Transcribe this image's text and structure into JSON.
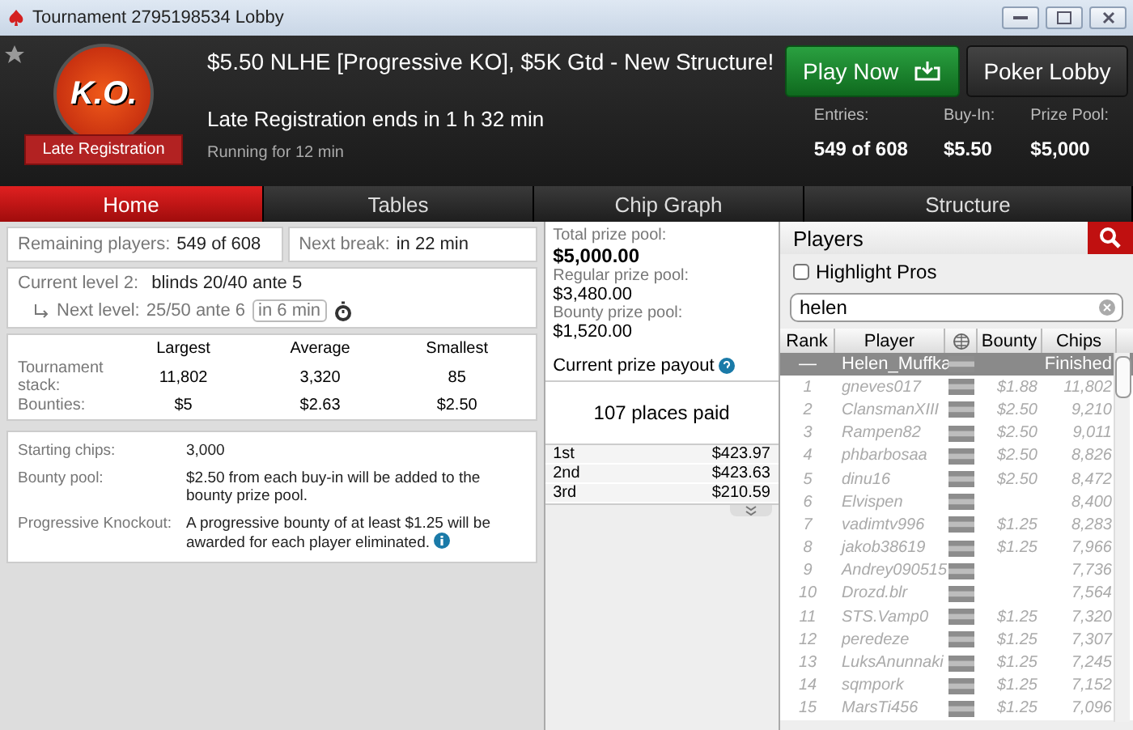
{
  "window": {
    "title": "Tournament 2795198534 Lobby"
  },
  "header": {
    "badge_text": "K.O.",
    "ribbon": "Late Registration",
    "title": "$5.50 NLHE [Progressive KO], $5K Gtd - New Structure!",
    "late_reg": "Late Registration ends in 1 h 32 min",
    "running": "Running for 12 min",
    "play_button": "Play Now",
    "lobby_button": "Poker Lobby",
    "stats": [
      {
        "label": "Entries:",
        "value": "549 of 608"
      },
      {
        "label": "Buy-In:",
        "value": "$5.50"
      },
      {
        "label": "Prize Pool:",
        "value": "$5,000"
      }
    ]
  },
  "tabs": [
    {
      "label": "Home",
      "selected": true
    },
    {
      "label": "Tables",
      "selected": false
    },
    {
      "label": "Chip Graph",
      "selected": false
    },
    {
      "label": "Structure",
      "selected": false
    }
  ],
  "home": {
    "remaining_label": "Remaining players:",
    "remaining_value": "549 of 608",
    "break_label": "Next break:",
    "break_value": "in 22 min",
    "level_label": "Current level 2:",
    "level_value": "blinds 20/40 ante 5",
    "next_label": "Next level:",
    "next_value": "25/50 ante 6",
    "next_time": "in 6 min",
    "stack_columns": [
      "Largest",
      "Average",
      "Smallest"
    ],
    "stack_rows": [
      {
        "label": "Tournament stack:",
        "values": [
          "11,802",
          "3,320",
          "85"
        ]
      },
      {
        "label": "Bounties:",
        "values": [
          "$5",
          "$2.63",
          "$2.50"
        ]
      }
    ],
    "info": [
      {
        "label": "Starting chips:",
        "value": "3,000",
        "info_icon": false
      },
      {
        "label": "Bounty pool:",
        "value": "$2.50 from each buy-in will be added to the bounty prize pool.",
        "info_icon": false
      },
      {
        "label": "Progressive Knockout:",
        "value": "A progressive bounty of at least $1.25 will be awarded for each player eliminated.",
        "info_icon": true
      }
    ]
  },
  "prizes": {
    "pools": [
      {
        "label": "Total prize pool:",
        "value": "$5,000.00",
        "major": true
      },
      {
        "label": "Regular prize pool:",
        "value": "$3,480.00",
        "major": false
      },
      {
        "label": "Bounty prize pool:",
        "value": "$1,520.00",
        "major": false
      }
    ],
    "payout_title": "Current prize payout",
    "places_paid": "107 places paid",
    "payouts": [
      {
        "place": "1st",
        "amount": "$423.97"
      },
      {
        "place": "2nd",
        "amount": "$423.63"
      },
      {
        "place": "3rd",
        "amount": "$210.59"
      }
    ]
  },
  "players": {
    "title": "Players",
    "highlight_pros": {
      "label": "Highlight Pros",
      "checked": false
    },
    "search": {
      "value": "helen"
    },
    "columns": [
      "Rank",
      "Player",
      "Bounty",
      "Chips"
    ],
    "rows": [
      {
        "rank": "—",
        "player": "Helen_Muffka",
        "bounty": "",
        "chips": "Finished",
        "selected": true
      },
      {
        "rank": "1",
        "player": "gneves017",
        "bounty": "$1.88",
        "chips": "11,802",
        "selected": false
      },
      {
        "rank": "2",
        "player": "ClansmanXIII",
        "bounty": "$2.50",
        "chips": "9,210",
        "selected": false
      },
      {
        "rank": "3",
        "player": "Rampen82",
        "bounty": "$2.50",
        "chips": "9,011",
        "selected": false
      },
      {
        "rank": "4",
        "player": "phbarbosaa",
        "bounty": "$2.50",
        "chips": "8,826",
        "selected": false
      },
      {
        "rank": "5",
        "player": "dinu16",
        "bounty": "$2.50",
        "chips": "8,472",
        "selected": false
      },
      {
        "rank": "6",
        "player": "Elvispen",
        "bounty": "",
        "chips": "8,400",
        "selected": false
      },
      {
        "rank": "7",
        "player": "vadimtv996",
        "bounty": "$1.25",
        "chips": "8,283",
        "selected": false
      },
      {
        "rank": "8",
        "player": "jakob38619",
        "bounty": "$1.25",
        "chips": "7,966",
        "selected": false
      },
      {
        "rank": "9",
        "player": "Andrey090515",
        "bounty": "",
        "chips": "7,736",
        "selected": false
      },
      {
        "rank": "10",
        "player": "Drozd.blr",
        "bounty": "",
        "chips": "7,564",
        "selected": false
      },
      {
        "rank": "11",
        "player": "STS.Vamp0",
        "bounty": "$1.25",
        "chips": "7,320",
        "selected": false
      },
      {
        "rank": "12",
        "player": "peredeze",
        "bounty": "$1.25",
        "chips": "7,307",
        "selected": false
      },
      {
        "rank": "13",
        "player": "LuksAnunnaki",
        "bounty": "$1.25",
        "chips": "7,245",
        "selected": false
      },
      {
        "rank": "14",
        "player": "sqmpork",
        "bounty": "$1.25",
        "chips": "7,152",
        "selected": false
      },
      {
        "rank": "15",
        "player": "MarsTi456",
        "bounty": "$1.25",
        "chips": "7,096",
        "selected": false
      }
    ]
  }
}
